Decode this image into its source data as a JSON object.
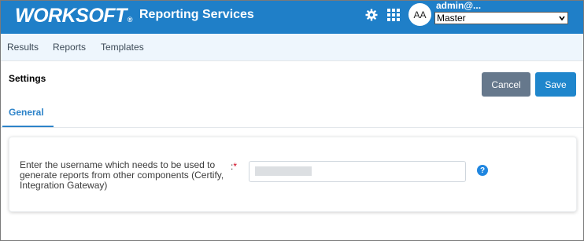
{
  "header": {
    "logo_text": "WORKSOFT",
    "logo_mark": "®",
    "app_title": "Reporting Services",
    "icons": [
      "gear-icon",
      "apps-grid-icon"
    ],
    "avatar_initials": "AA",
    "username": "admin@...",
    "project_selected": "Master",
    "color": "#1f7fc8"
  },
  "nav": {
    "items": [
      {
        "label": "Results"
      },
      {
        "label": "Reports"
      },
      {
        "label": "Templates"
      }
    ]
  },
  "page": {
    "title": "Settings",
    "cancel_label": "Cancel",
    "save_label": "Save",
    "tabs": [
      {
        "label": "General",
        "active": true
      }
    ]
  },
  "form": {
    "field_label": "Enter the username which needs to be used to generate reports from other components (Certify, Integration Gateway)",
    "required_prefix": ":",
    "required_mark": "*",
    "value": "",
    "help_symbol": "?"
  },
  "colors": {
    "accent": "#1f86cc",
    "cancel": "#66788c",
    "required": "#d0021b"
  }
}
